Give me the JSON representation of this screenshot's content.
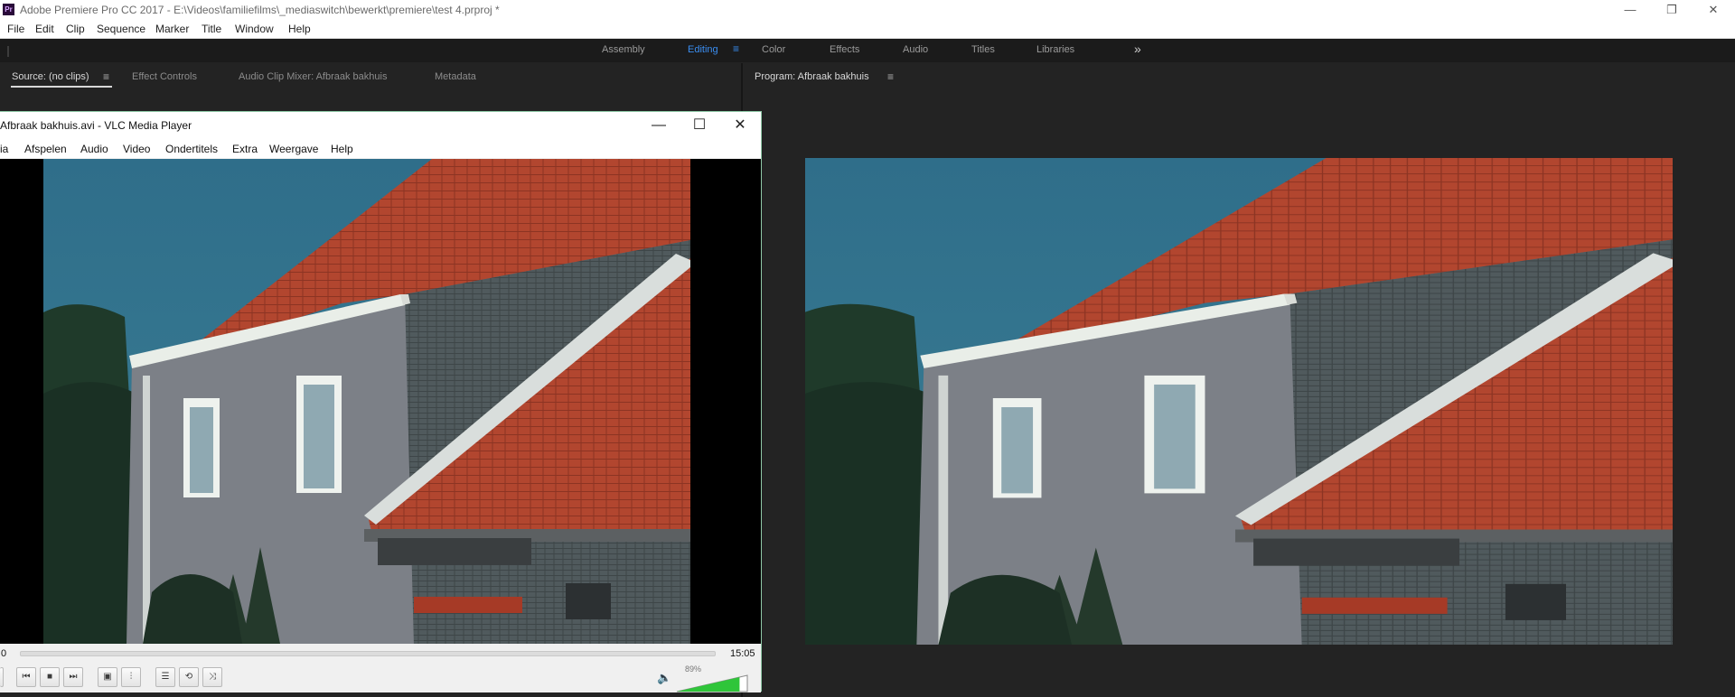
{
  "premiere": {
    "logo": "Pr",
    "window_title": "Adobe Premiere Pro CC 2017 - E:\\Videos\\familiefilms\\_mediaswitch\\bewerkt\\premiere\\test 4.prproj *",
    "window_controls": {
      "minimize": "—",
      "restore": "❐",
      "close": "✕"
    },
    "menu": [
      "File",
      "Edit",
      "Clip",
      "Sequence",
      "Marker",
      "Title",
      "Window",
      "Help"
    ],
    "workspaces": [
      {
        "label": "Assembly",
        "active": false
      },
      {
        "label": "Editing",
        "active": true
      },
      {
        "label": "Color",
        "active": false
      },
      {
        "label": "Effects",
        "active": false
      },
      {
        "label": "Audio",
        "active": false
      },
      {
        "label": "Titles",
        "active": false
      },
      {
        "label": "Libraries",
        "active": false
      }
    ],
    "workspace_menu_glyph": "≡",
    "workspace_overflow_glyph": "»",
    "source_panel": {
      "tabs": [
        "Source: (no clips)",
        "Effect Controls",
        "Audio Clip Mixer: Afbraak bakhuis",
        "Metadata"
      ],
      "menu_glyph": "≡"
    },
    "program_panel": {
      "tab": "Program: Afbraak bakhuis",
      "menu_glyph": "≡"
    }
  },
  "vlc": {
    "window_title": "Afbraak bakhuis.avi - VLC Media Player",
    "window_controls": {
      "minimize": "—",
      "maximize": "☐",
      "close": "✕"
    },
    "menu": [
      "ia",
      "Afspelen",
      "Audio",
      "Video",
      "Ondertitels",
      "Extra",
      "Weergave",
      "Help"
    ],
    "time_elapsed": "0",
    "time_total": "15:05",
    "progress": 0.0,
    "volume_label": "89%",
    "volume": 0.89,
    "buttons": [
      {
        "name": "previous-button",
        "icon": "skip-previous-icon",
        "glyph": "⏮"
      },
      {
        "name": "stop-button",
        "icon": "stop-icon",
        "glyph": "■"
      },
      {
        "name": "next-button",
        "icon": "skip-next-icon",
        "glyph": "⏭"
      },
      {
        "name": "fullscreen-button",
        "icon": "fullscreen-icon",
        "glyph": "▣"
      },
      {
        "name": "extended-settings-button",
        "icon": "equalizer-icon",
        "glyph": "⫶"
      },
      {
        "name": "playlist-button",
        "icon": "playlist-icon",
        "glyph": "☰"
      },
      {
        "name": "loop-button",
        "icon": "loop-icon",
        "glyph": "⟲"
      },
      {
        "name": "shuffle-button",
        "icon": "shuffle-icon",
        "glyph": "⤨"
      }
    ],
    "volume_icon": "🔈"
  },
  "colors": {
    "accent_blue": "#3a8df0",
    "vlc_window_border": "#8fc9a7",
    "volume_green": "#2fc53a"
  }
}
